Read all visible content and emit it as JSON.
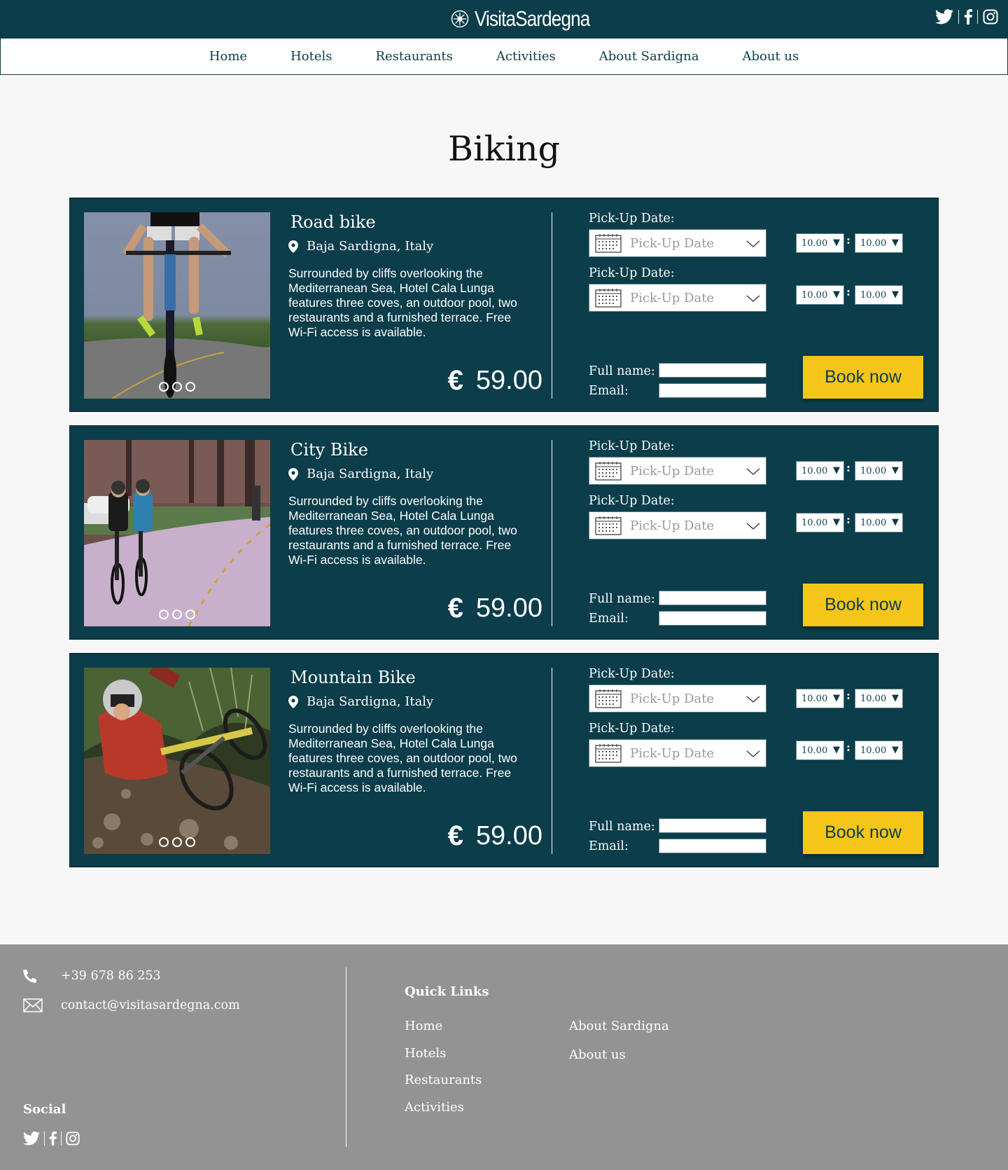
{
  "brand": {
    "name": "VisitaSardegna"
  },
  "nav": {
    "items": [
      "Home",
      "Hotels",
      "Restaurants",
      "Activities",
      "About Sardigna",
      "About us"
    ]
  },
  "page": {
    "title": "Biking"
  },
  "cards": [
    {
      "title": "Road bike",
      "location": "Baja Sardigna, Italy",
      "description": "Surrounded by cliffs overlooking the Mediterranean Sea, Hotel Cala Lunga features three coves, an outdoor pool, two restaurants and a furnished terrace. Free Wi-Fi access is available.",
      "currency": "€",
      "price": "59.00",
      "pickup_label_1": "Pick-Up Date:",
      "pickup_label_2": "Pick-Up Date:",
      "date_placeholder": "Pick-Up Date",
      "times": [
        "10.00",
        "10.00",
        "10.00",
        "10.00"
      ],
      "fullname_label": "Full name:",
      "email_label": "Email:",
      "book_label": "Book now"
    },
    {
      "title": "City Bike",
      "location": "Baja Sardigna, Italy",
      "description": "Surrounded by cliffs overlooking the Mediterranean Sea, Hotel Cala Lunga features three coves, an outdoor pool, two restaurants and a furnished terrace. Free Wi-Fi access is available.",
      "currency": "€",
      "price": "59.00",
      "pickup_label_1": "Pick-Up Date:",
      "pickup_label_2": "Pick-Up Date:",
      "date_placeholder": "Pick-Up Date",
      "times": [
        "10.00",
        "10.00",
        "10.00",
        "10.00"
      ],
      "fullname_label": "Full name:",
      "email_label": "Email:",
      "book_label": "Book now"
    },
    {
      "title": "Mountain Bike",
      "location": "Baja Sardigna, Italy",
      "description": "Surrounded by cliffs overlooking the Mediterranean Sea, Hotel Cala Lunga features three coves, an outdoor pool, two restaurants and a furnished terrace. Free Wi-Fi access is available.",
      "currency": "€",
      "price": "59.00",
      "pickup_label_1": "Pick-Up Date:",
      "pickup_label_2": "Pick-Up Date:",
      "date_placeholder": "Pick-Up Date",
      "times": [
        "10.00",
        "10.00",
        "10.00",
        "10.00"
      ],
      "fullname_label": "Full name:",
      "email_label": "Email:",
      "book_label": "Book now"
    }
  ],
  "footer": {
    "phone": "+39 678 86 253",
    "email": "contact@visitasardegna.com",
    "social_title": "Social",
    "quick_links_title": "Quick Links",
    "quick_links_col1": [
      "Home",
      "Hotels",
      "Restaurants",
      "Activities"
    ],
    "quick_links_col2": [
      "About Sardigna",
      "About us"
    ]
  },
  "colors": {
    "primary": "#0b3d4a",
    "accent": "#f5c518",
    "footer": "#939393",
    "page_bg": "#f7f7f7"
  },
  "icons": [
    "logo-mark-icon",
    "twitter-icon",
    "facebook-icon",
    "instagram-icon",
    "location-pin-icon",
    "calendar-icon",
    "chevron-down-icon",
    "phone-icon",
    "mail-icon"
  ]
}
